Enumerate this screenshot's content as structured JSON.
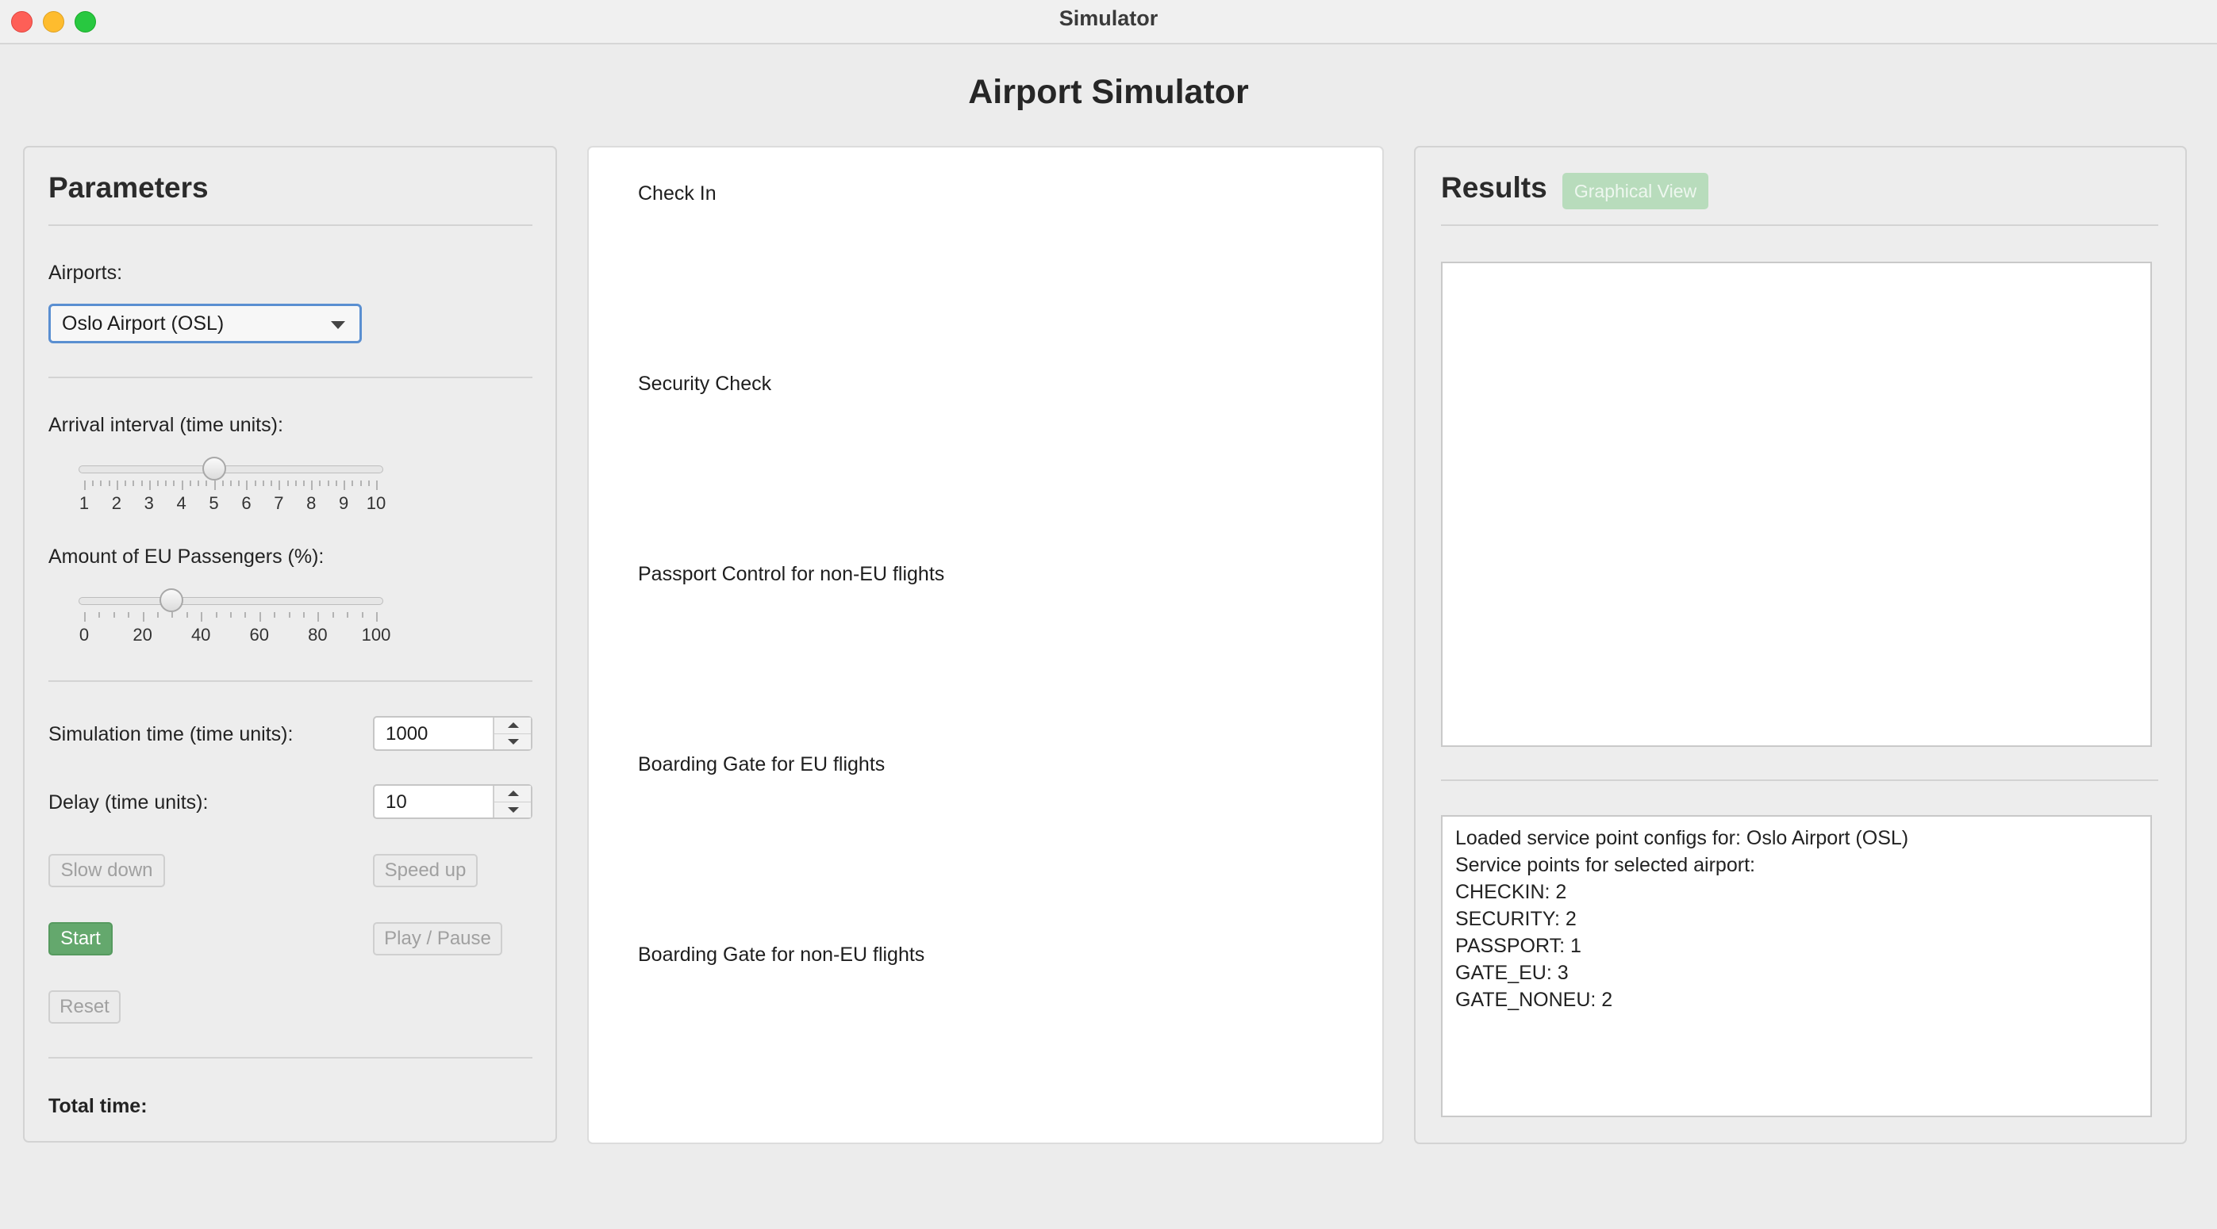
{
  "window": {
    "title": "Simulator"
  },
  "app": {
    "title": "Airport Simulator"
  },
  "params": {
    "title": "Parameters",
    "airports_label": "Airports:",
    "airport_selected": "Oslo Airport (OSL)",
    "arrival_label": "Arrival interval (time units):",
    "arrival_ticks": [
      "1",
      "2",
      "3",
      "4",
      "5",
      "6",
      "7",
      "8",
      "9",
      "10"
    ],
    "arrival_value": 5,
    "arrival_range": [
      1,
      10
    ],
    "eu_label": "Amount of EU Passengers (%):",
    "eu_ticks": [
      "0",
      "20",
      "40",
      "60",
      "80",
      "100"
    ],
    "eu_value": 30,
    "eu_range": [
      0,
      100
    ],
    "sim_time_label": "Simulation time (time units):",
    "sim_time_value": "1000",
    "delay_label": "Delay (time units):",
    "delay_value": "10",
    "slow_down": "Slow down",
    "speed_up": "Speed up",
    "start": "Start",
    "play_pause": "Play / Pause",
    "reset": "Reset",
    "total_time_label": "Total time:"
  },
  "stages": [
    "Check In",
    "Security Check",
    "Passport Control for non-EU flights",
    "Boarding Gate for EU flights",
    "Boarding Gate for non-EU flights"
  ],
  "results": {
    "title": "Results",
    "graphical_view": "Graphical View",
    "log": [
      "Loaded service point configs for: Oslo Airport (OSL)",
      "Service points for selected airport:",
      "CHECKIN: 2",
      "SECURITY: 2",
      "PASSPORT: 1",
      "GATE_EU: 3",
      "GATE_NONEU: 2"
    ]
  },
  "colors": {
    "start_button": "#64a86d",
    "graphical_view_button": "#b8dcbc",
    "select_focus": "#5a8fd1"
  }
}
